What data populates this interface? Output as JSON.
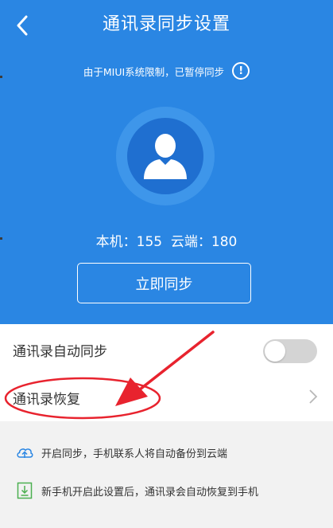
{
  "header": {
    "title": "通讯录同步设置",
    "back_icon": "chevron-left-icon"
  },
  "notice": {
    "text": "由于MIUI系统限制，已暂停同步",
    "icon": "info-icon"
  },
  "stats": {
    "text": "本机：155  云端：180",
    "local": 155,
    "cloud": 180
  },
  "actions": {
    "sync_now": "立即同步"
  },
  "settings": [
    {
      "label": "通讯录自动同步",
      "control": "toggle",
      "on": false
    },
    {
      "label": "通讯录恢复",
      "control": "chevron"
    }
  ],
  "tips": [
    {
      "icon": "cloud-upload-icon",
      "text": "开启同步，手机联系人将自动备份到云端"
    },
    {
      "icon": "download-box-icon",
      "text": "新手机开启此设置后，通讯录会自动恢复到手机"
    }
  ],
  "colors": {
    "primary": "#2a86e3",
    "annotation": "#e8232e",
    "tip_green": "#4caf50",
    "tip_blue": "#2a86e3"
  }
}
